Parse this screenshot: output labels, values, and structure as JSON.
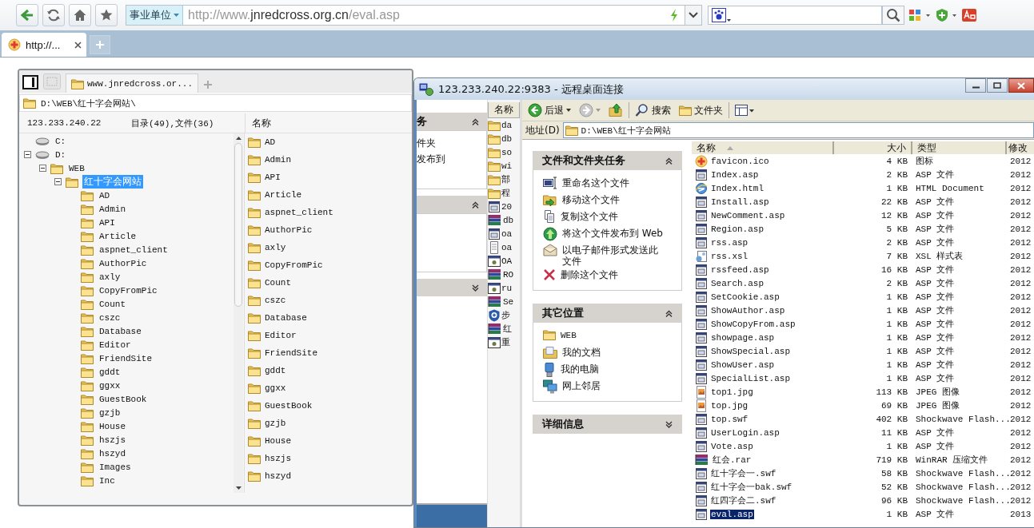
{
  "address_bar": {
    "scope": "事业单位",
    "url_prefix": "http://www.",
    "url_host": "jnredcross.org.cn",
    "url_path": "/eval.asp"
  },
  "tabs": [
    {
      "label": "http://...",
      "selected": true
    }
  ],
  "app": {
    "tabs": [
      {
        "label": "www.jnredcross.or...",
        "selected": true
      }
    ],
    "path": "D:\\WEB\\红十字会网站\\",
    "host": "123.233.240.22",
    "summary": "目录(49),文件(36)",
    "list_header": "名称",
    "tree": [
      {
        "label": "C:",
        "kind": "drive",
        "selected": false
      },
      {
        "label": "D:",
        "kind": "drive",
        "selected": false,
        "expanded": true,
        "children": [
          {
            "label": "WEB",
            "kind": "folder",
            "selected": false,
            "expanded": true,
            "children": [
              {
                "label": "红十字会网站",
                "kind": "folder",
                "selected": true,
                "expanded": true,
                "children": [
                  {
                    "label": "AD",
                    "kind": "folder",
                    "selected": false
                  },
                  {
                    "label": "Admin",
                    "kind": "folder",
                    "selected": false
                  },
                  {
                    "label": "API",
                    "kind": "folder",
                    "selected": false
                  },
                  {
                    "label": "Article",
                    "kind": "folder",
                    "selected": false
                  },
                  {
                    "label": "aspnet_client",
                    "kind": "folder",
                    "selected": false
                  },
                  {
                    "label": "AuthorPic",
                    "kind": "folder",
                    "selected": false
                  },
                  {
                    "label": "axly",
                    "kind": "folder",
                    "selected": false
                  },
                  {
                    "label": "CopyFromPic",
                    "kind": "folder",
                    "selected": false
                  },
                  {
                    "label": "Count",
                    "kind": "folder",
                    "selected": false
                  },
                  {
                    "label": "cszc",
                    "kind": "folder",
                    "selected": false
                  },
                  {
                    "label": "Database",
                    "kind": "folder",
                    "selected": false
                  },
                  {
                    "label": "Editor",
                    "kind": "folder",
                    "selected": false
                  },
                  {
                    "label": "FriendSite",
                    "kind": "folder",
                    "selected": false
                  },
                  {
                    "label": "gddt",
                    "kind": "folder",
                    "selected": false
                  },
                  {
                    "label": "ggxx",
                    "kind": "folder",
                    "selected": false
                  },
                  {
                    "label": "GuestBook",
                    "kind": "folder",
                    "selected": false
                  },
                  {
                    "label": "gzjb",
                    "kind": "folder",
                    "selected": false
                  },
                  {
                    "label": "House",
                    "kind": "folder",
                    "selected": false
                  },
                  {
                    "label": "hszjs",
                    "kind": "folder",
                    "selected": false
                  },
                  {
                    "label": "hszyd",
                    "kind": "folder",
                    "selected": false
                  },
                  {
                    "label": "Images",
                    "kind": "folder",
                    "selected": false
                  },
                  {
                    "label": "Inc",
                    "kind": "folder",
                    "selected": false
                  }
                ]
              }
            ]
          }
        ]
      }
    ],
    "list": [
      "AD",
      "Admin",
      "API",
      "Article",
      "aspnet_client",
      "AuthorPic",
      "axly",
      "CopyFromPic",
      "Count",
      "cszc",
      "Database",
      "Editor",
      "FriendSite",
      "gddt",
      "ggxx",
      "GuestBook",
      "gzjb",
      "House",
      "hszjs",
      "hszyd"
    ]
  },
  "rdp": {
    "title": "123.233.240.22:9383 - 远程桌面连接",
    "left_panes": [
      {
        "title": "务",
        "expanded": true,
        "items": [
          "件夹",
          "发布到"
        ]
      },
      {
        "expanded": true
      },
      {
        "expanded": false
      }
    ],
    "narrow_column": {
      "header": "名称",
      "items": [
        {
          "name": "da",
          "kind": "folder"
        },
        {
          "name": "db",
          "kind": "folder"
        },
        {
          "name": "so",
          "kind": "folder"
        },
        {
          "name": "wi",
          "kind": "folder"
        },
        {
          "name": "部",
          "kind": "folder"
        },
        {
          "name": "程",
          "kind": "folder"
        },
        {
          "name": "20",
          "kind": "asp"
        },
        {
          "name": "db",
          "kind": "rar"
        },
        {
          "name": "oa",
          "kind": "asp"
        },
        {
          "name": "oa",
          "kind": "text"
        },
        {
          "name": "OA",
          "kind": "app"
        },
        {
          "name": "RO",
          "kind": "rar"
        },
        {
          "name": "ru",
          "kind": "app"
        },
        {
          "name": "Se",
          "kind": "rar"
        },
        {
          "name": "步",
          "kind": "shield"
        },
        {
          "name": "红",
          "kind": "rar"
        },
        {
          "name": "重",
          "kind": "app"
        }
      ]
    },
    "toolbar": {
      "back": "后退",
      "search": "搜索",
      "folders": "文件夹"
    },
    "address": {
      "label": "地址(D)",
      "value": "D:\\WEB\\红十字会网站"
    },
    "task_panes": [
      {
        "title": "文件和文件夹任务",
        "expanded": true,
        "items": [
          {
            "label": "重命名这个文件",
            "kind": "rename"
          },
          {
            "label": "移动这个文件",
            "kind": "move"
          },
          {
            "label": "复制这个文件",
            "kind": "copy"
          },
          {
            "label": "将这个文件发布到 Web",
            "kind": "publish"
          },
          {
            "label": "以电子邮件形式发送此文件",
            "kind": "email"
          },
          {
            "label": "删除这个文件",
            "kind": "delete"
          }
        ]
      },
      {
        "title": "其它位置",
        "expanded": true,
        "items": [
          {
            "label": "WEB",
            "kind": "folder"
          },
          {
            "label": "我的文档",
            "kind": "documents"
          },
          {
            "label": "我的电脑",
            "kind": "computer"
          },
          {
            "label": "网上邻居",
            "kind": "network"
          }
        ]
      },
      {
        "title": "详细信息",
        "expanded": false
      }
    ],
    "files": {
      "columns": [
        "名称",
        "大小",
        "类型",
        "修改"
      ],
      "rows": [
        {
          "name": "favicon.ico",
          "size": "4 KB",
          "type": "图标",
          "modified": "2012",
          "kind": "ico",
          "selected": false
        },
        {
          "name": "Index.asp",
          "size": "2 KB",
          "type": "ASP 文件",
          "modified": "2012",
          "kind": "asp",
          "selected": false
        },
        {
          "name": "Index.html",
          "size": "1 KB",
          "type": "HTML Document",
          "modified": "2012",
          "kind": "html",
          "selected": false
        },
        {
          "name": "Install.asp",
          "size": "22 KB",
          "type": "ASP 文件",
          "modified": "2012",
          "kind": "asp",
          "selected": false
        },
        {
          "name": "NewComment.asp",
          "size": "12 KB",
          "type": "ASP 文件",
          "modified": "2012",
          "kind": "asp",
          "selected": false
        },
        {
          "name": "Region.asp",
          "size": "5 KB",
          "type": "ASP 文件",
          "modified": "2012",
          "kind": "asp",
          "selected": false
        },
        {
          "name": "rss.asp",
          "size": "2 KB",
          "type": "ASP 文件",
          "modified": "2012",
          "kind": "asp",
          "selected": false
        },
        {
          "name": "rss.xsl",
          "size": "7 KB",
          "type": "XSL 样式表",
          "modified": "2012",
          "kind": "xsl",
          "selected": false
        },
        {
          "name": "rssfeed.asp",
          "size": "16 KB",
          "type": "ASP 文件",
          "modified": "2012",
          "kind": "asp",
          "selected": false
        },
        {
          "name": "Search.asp",
          "size": "2 KB",
          "type": "ASP 文件",
          "modified": "2012",
          "kind": "asp",
          "selected": false
        },
        {
          "name": "SetCookie.asp",
          "size": "1 KB",
          "type": "ASP 文件",
          "modified": "2012",
          "kind": "asp",
          "selected": false
        },
        {
          "name": "ShowAuthor.asp",
          "size": "1 KB",
          "type": "ASP 文件",
          "modified": "2012",
          "kind": "asp",
          "selected": false
        },
        {
          "name": "ShowCopyFrom.asp",
          "size": "1 KB",
          "type": "ASP 文件",
          "modified": "2012",
          "kind": "asp",
          "selected": false
        },
        {
          "name": "showpage.asp",
          "size": "1 KB",
          "type": "ASP 文件",
          "modified": "2012",
          "kind": "asp",
          "selected": false
        },
        {
          "name": "ShowSpecial.asp",
          "size": "1 KB",
          "type": "ASP 文件",
          "modified": "2012",
          "kind": "asp",
          "selected": false
        },
        {
          "name": "ShowUser.asp",
          "size": "1 KB",
          "type": "ASP 文件",
          "modified": "2012",
          "kind": "asp",
          "selected": false
        },
        {
          "name": "SpecialList.asp",
          "size": "1 KB",
          "type": "ASP 文件",
          "modified": "2012",
          "kind": "asp",
          "selected": false
        },
        {
          "name": "top1.jpg",
          "size": "113 KB",
          "type": "JPEG 图像",
          "modified": "2012",
          "kind": "jpg",
          "selected": false
        },
        {
          "name": "top.jpg",
          "size": "69 KB",
          "type": "JPEG 图像",
          "modified": "2012",
          "kind": "jpg",
          "selected": false
        },
        {
          "name": "top.swf",
          "size": "402 KB",
          "type": "Shockwave Flash...",
          "modified": "2012",
          "kind": "swf",
          "selected": false
        },
        {
          "name": "UserLogin.asp",
          "size": "11 KB",
          "type": "ASP 文件",
          "modified": "2012",
          "kind": "asp",
          "selected": false
        },
        {
          "name": "Vote.asp",
          "size": "1 KB",
          "type": "ASP 文件",
          "modified": "2012",
          "kind": "asp",
          "selected": false
        },
        {
          "name": "红会.rar",
          "size": "719 KB",
          "type": "WinRAR 压缩文件",
          "modified": "2012",
          "kind": "rar",
          "selected": false
        },
        {
          "name": "红十字会一.swf",
          "size": "58 KB",
          "type": "Shockwave Flash...",
          "modified": "2012",
          "kind": "swf",
          "selected": false
        },
        {
          "name": "红十字会一bak.swf",
          "size": "52 KB",
          "type": "Shockwave Flash...",
          "modified": "2012",
          "kind": "swf",
          "selected": false
        },
        {
          "name": "红四字会二.swf",
          "size": "96 KB",
          "type": "Shockwave Flash...",
          "modified": "2012",
          "kind": "swf",
          "selected": false
        },
        {
          "name": "eval.asp",
          "size": "1 KB",
          "type": "ASP 文件",
          "modified": "2013",
          "kind": "asp",
          "selected": true
        }
      ]
    }
  }
}
